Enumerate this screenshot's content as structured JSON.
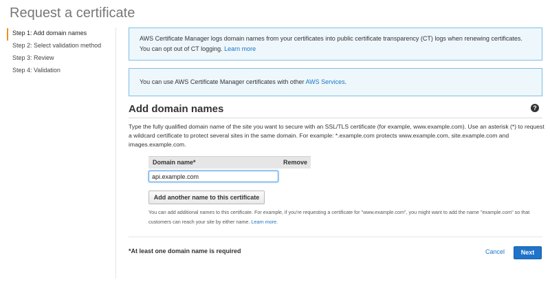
{
  "page": {
    "title": "Request a certificate"
  },
  "steps": [
    {
      "label": "Step 1: Add domain names",
      "active": true
    },
    {
      "label": "Step 2: Select validation method",
      "active": false
    },
    {
      "label": "Step 3: Review",
      "active": false
    },
    {
      "label": "Step 4: Validation",
      "active": false
    }
  ],
  "info1": {
    "text": "AWS Certificate Manager logs domain names from your certificates into public certificate transparency (CT) logs when renewing certificates. You can opt out of CT logging.",
    "link": "Learn more"
  },
  "info2": {
    "text": "You can use AWS Certificate Manager certificates with other",
    "link": "AWS Services",
    "suffix": "."
  },
  "section": {
    "title": "Add domain names",
    "help_icon": "help-circle-icon",
    "description": "Type the fully qualified domain name of the site you want to secure with an SSL/TLS certificate (for example, www.example.com). Use an asterisk (*) to request a wildcard certificate to protect several sites in the same domain. For example: *.example.com protects www.example.com, site.example.com and images.example.com."
  },
  "domain_table": {
    "col_domain": "Domain name*",
    "col_remove": "Remove",
    "input_value": "api.example.com"
  },
  "add_button": "Add another name to this certificate",
  "hint": {
    "text": "You can add additional names to this certificate. For example, if you're requesting a certificate for \"www.example.com\", you might want to add the name \"example.com\" so that customers can reach your site by either name.",
    "link": "Learn more."
  },
  "footer": {
    "required_note": "*At least one domain name is required",
    "cancel": "Cancel",
    "next": "Next"
  },
  "colors": {
    "accent": "#f0911e",
    "primary": "#1f73c9",
    "link": "#1b74c5",
    "info_bg": "#eef7fc",
    "info_border": "#7fbde3"
  }
}
